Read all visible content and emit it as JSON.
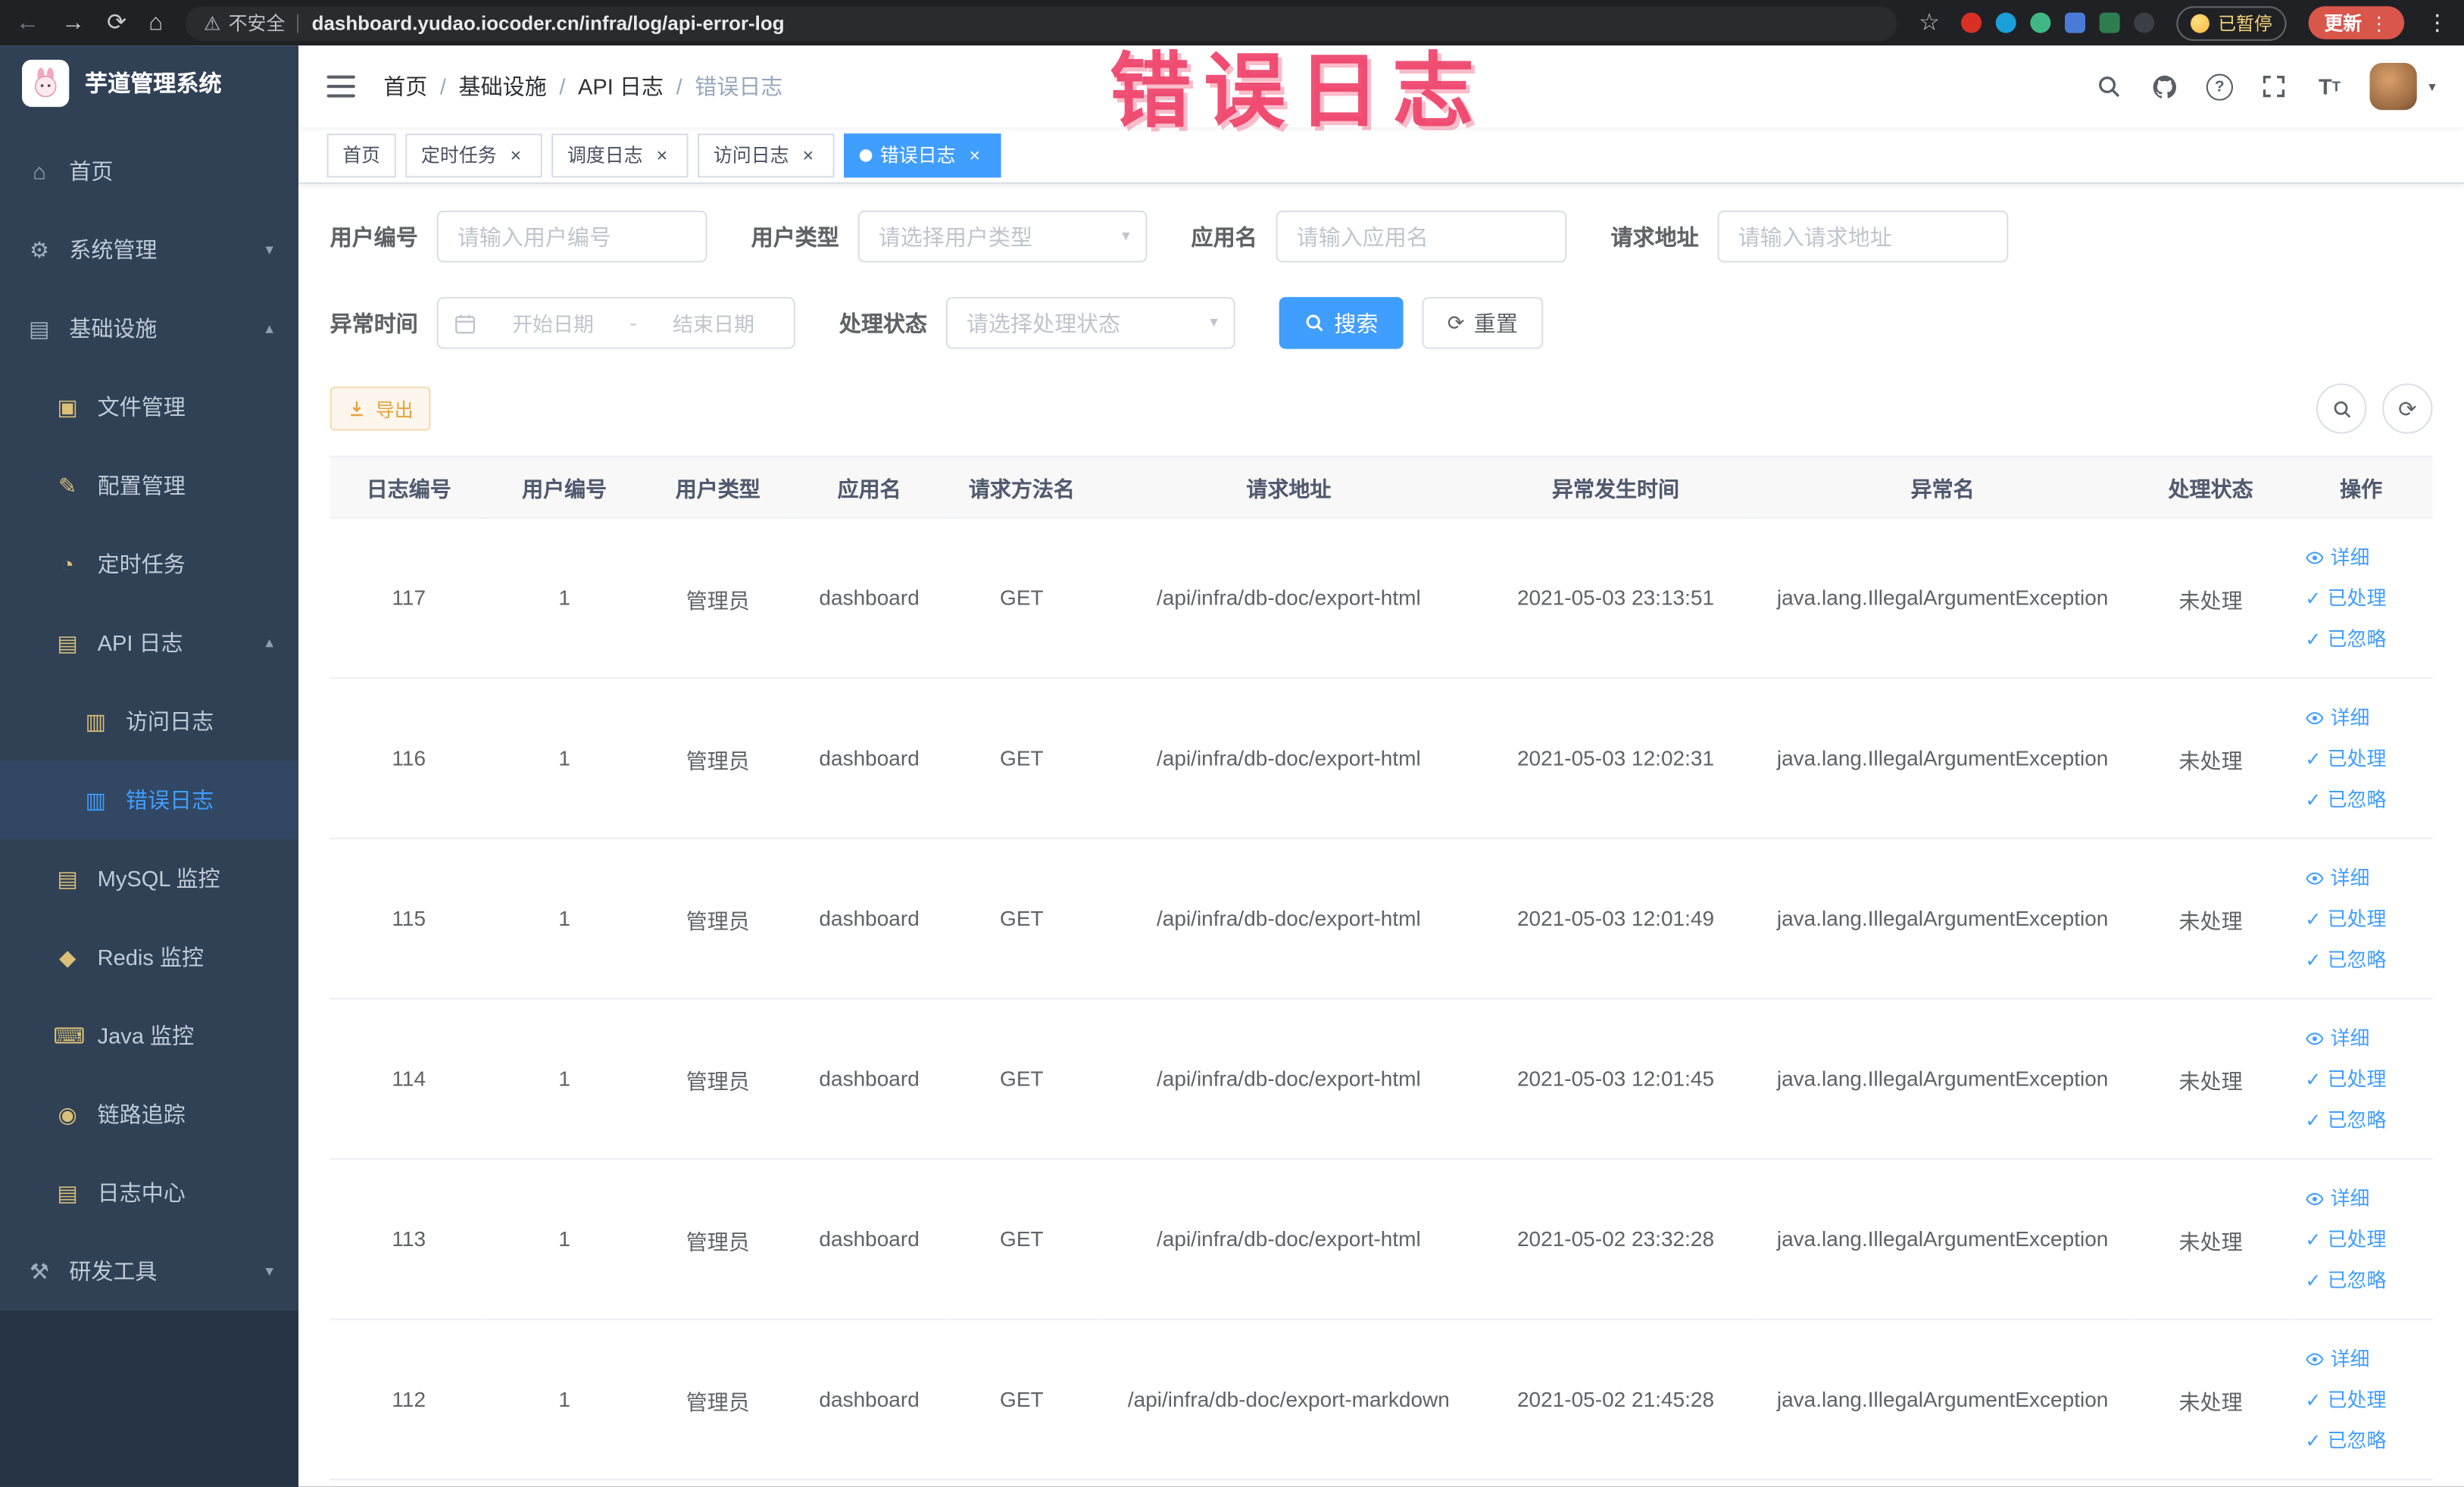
{
  "colors": {
    "primary": "#409EFF",
    "warning": "#E6A23C",
    "sidebar_bg": "#304156",
    "annotation": "#EE3E67",
    "update_button_bg": "#D9564A"
  },
  "browser": {
    "security_label": "不安全",
    "url": "dashboard.yudao.iocoder.cn/infra/log/api-error-log",
    "paused_badge": "已暂停",
    "update_button": "更新"
  },
  "annotation": {
    "text": "错误日志"
  },
  "sidebar": {
    "logo_title": "芋道管理系统",
    "items": [
      {
        "label": "首页",
        "icon": "home-icon",
        "level": 1
      },
      {
        "label": "系统管理",
        "icon": "gear-icon",
        "level": 1,
        "chevron": "down"
      },
      {
        "label": "基础设施",
        "icon": "infrastructure-icon",
        "level": 1,
        "chevron": "up"
      },
      {
        "label": "文件管理",
        "icon": "file-icon",
        "level": 2
      },
      {
        "label": "配置管理",
        "icon": "config-icon",
        "level": 2
      },
      {
        "label": "定时任务",
        "icon": "timer-icon",
        "level": 2
      },
      {
        "label": "API 日志",
        "icon": "api-log-icon",
        "level": 2,
        "chevron": "up"
      },
      {
        "label": "访问日志",
        "icon": "access-log-icon",
        "level": 3
      },
      {
        "label": "错误日志",
        "icon": "error-log-icon",
        "level": 3,
        "active": true
      },
      {
        "label": "MySQL 监控",
        "icon": "mysql-icon",
        "level": 2
      },
      {
        "label": "Redis 监控",
        "icon": "redis-icon",
        "level": 2
      },
      {
        "label": "Java 监控",
        "icon": "java-icon",
        "level": 2
      },
      {
        "label": "链路追踪",
        "icon": "trace-icon",
        "level": 2
      },
      {
        "label": "日志中心",
        "icon": "log-center-icon",
        "level": 2
      },
      {
        "label": "研发工具",
        "icon": "tools-icon",
        "level": 1,
        "chevron": "down"
      }
    ]
  },
  "header": {
    "breadcrumb": [
      "首页",
      "基础设施",
      "API 日志",
      "错误日志"
    ]
  },
  "tags": [
    {
      "label": "首页"
    },
    {
      "label": "定时任务"
    },
    {
      "label": "调度日志"
    },
    {
      "label": "访问日志"
    },
    {
      "label": "错误日志"
    }
  ],
  "filters": {
    "user_id": {
      "label": "用户编号",
      "placeholder": "请输入用户编号"
    },
    "user_type": {
      "label": "用户类型",
      "placeholder": "请选择用户类型"
    },
    "app_name": {
      "label": "应用名",
      "placeholder": "请输入应用名"
    },
    "request_url": {
      "label": "请求地址",
      "placeholder": "请输入请求地址"
    },
    "exception_time": {
      "label": "异常时间",
      "start_placeholder": "开始日期",
      "separator": "-",
      "end_placeholder": "结束日期"
    },
    "process_status": {
      "label": "处理状态",
      "placeholder": "请选择处理状态"
    },
    "search_label": "搜索",
    "reset_label": "重置"
  },
  "toolbar": {
    "export_label": "导出"
  },
  "table": {
    "columns": [
      "日志编号",
      "用户编号",
      "用户类型",
      "应用名",
      "请求方法名",
      "请求地址",
      "异常发生时间",
      "异常名",
      "处理状态",
      "操作"
    ],
    "action_labels": [
      "详细",
      "已处理",
      "已忽略"
    ],
    "rows": [
      {
        "id": "117",
        "user_id": "1",
        "user_type": "管理员",
        "app": "dashboard",
        "method": "GET",
        "url": "/api/infra/db-doc/export-html",
        "time": "2021-05-03 23:13:51",
        "exception": "java.lang.IllegalArgumentException",
        "status": "未处理"
      },
      {
        "id": "116",
        "user_id": "1",
        "user_type": "管理员",
        "app": "dashboard",
        "method": "GET",
        "url": "/api/infra/db-doc/export-html",
        "time": "2021-05-03 12:02:31",
        "exception": "java.lang.IllegalArgumentException",
        "status": "未处理"
      },
      {
        "id": "115",
        "user_id": "1",
        "user_type": "管理员",
        "app": "dashboard",
        "method": "GET",
        "url": "/api/infra/db-doc/export-html",
        "time": "2021-05-03 12:01:49",
        "exception": "java.lang.IllegalArgumentException",
        "status": "未处理"
      },
      {
        "id": "114",
        "user_id": "1",
        "user_type": "管理员",
        "app": "dashboard",
        "method": "GET",
        "url": "/api/infra/db-doc/export-html",
        "time": "2021-05-03 12:01:45",
        "exception": "java.lang.IllegalArgumentException",
        "status": "未处理"
      },
      {
        "id": "113",
        "user_id": "1",
        "user_type": "管理员",
        "app": "dashboard",
        "method": "GET",
        "url": "/api/infra/db-doc/export-html",
        "time": "2021-05-02 23:32:28",
        "exception": "java.lang.IllegalArgumentException",
        "status": "未处理"
      },
      {
        "id": "112",
        "user_id": "1",
        "user_type": "管理员",
        "app": "dashboard",
        "method": "GET",
        "url": "/api/infra/db-doc/export-markdown",
        "time": "2021-05-02 21:45:28",
        "exception": "java.lang.IllegalArgumentException",
        "status": "未处理"
      }
    ]
  }
}
